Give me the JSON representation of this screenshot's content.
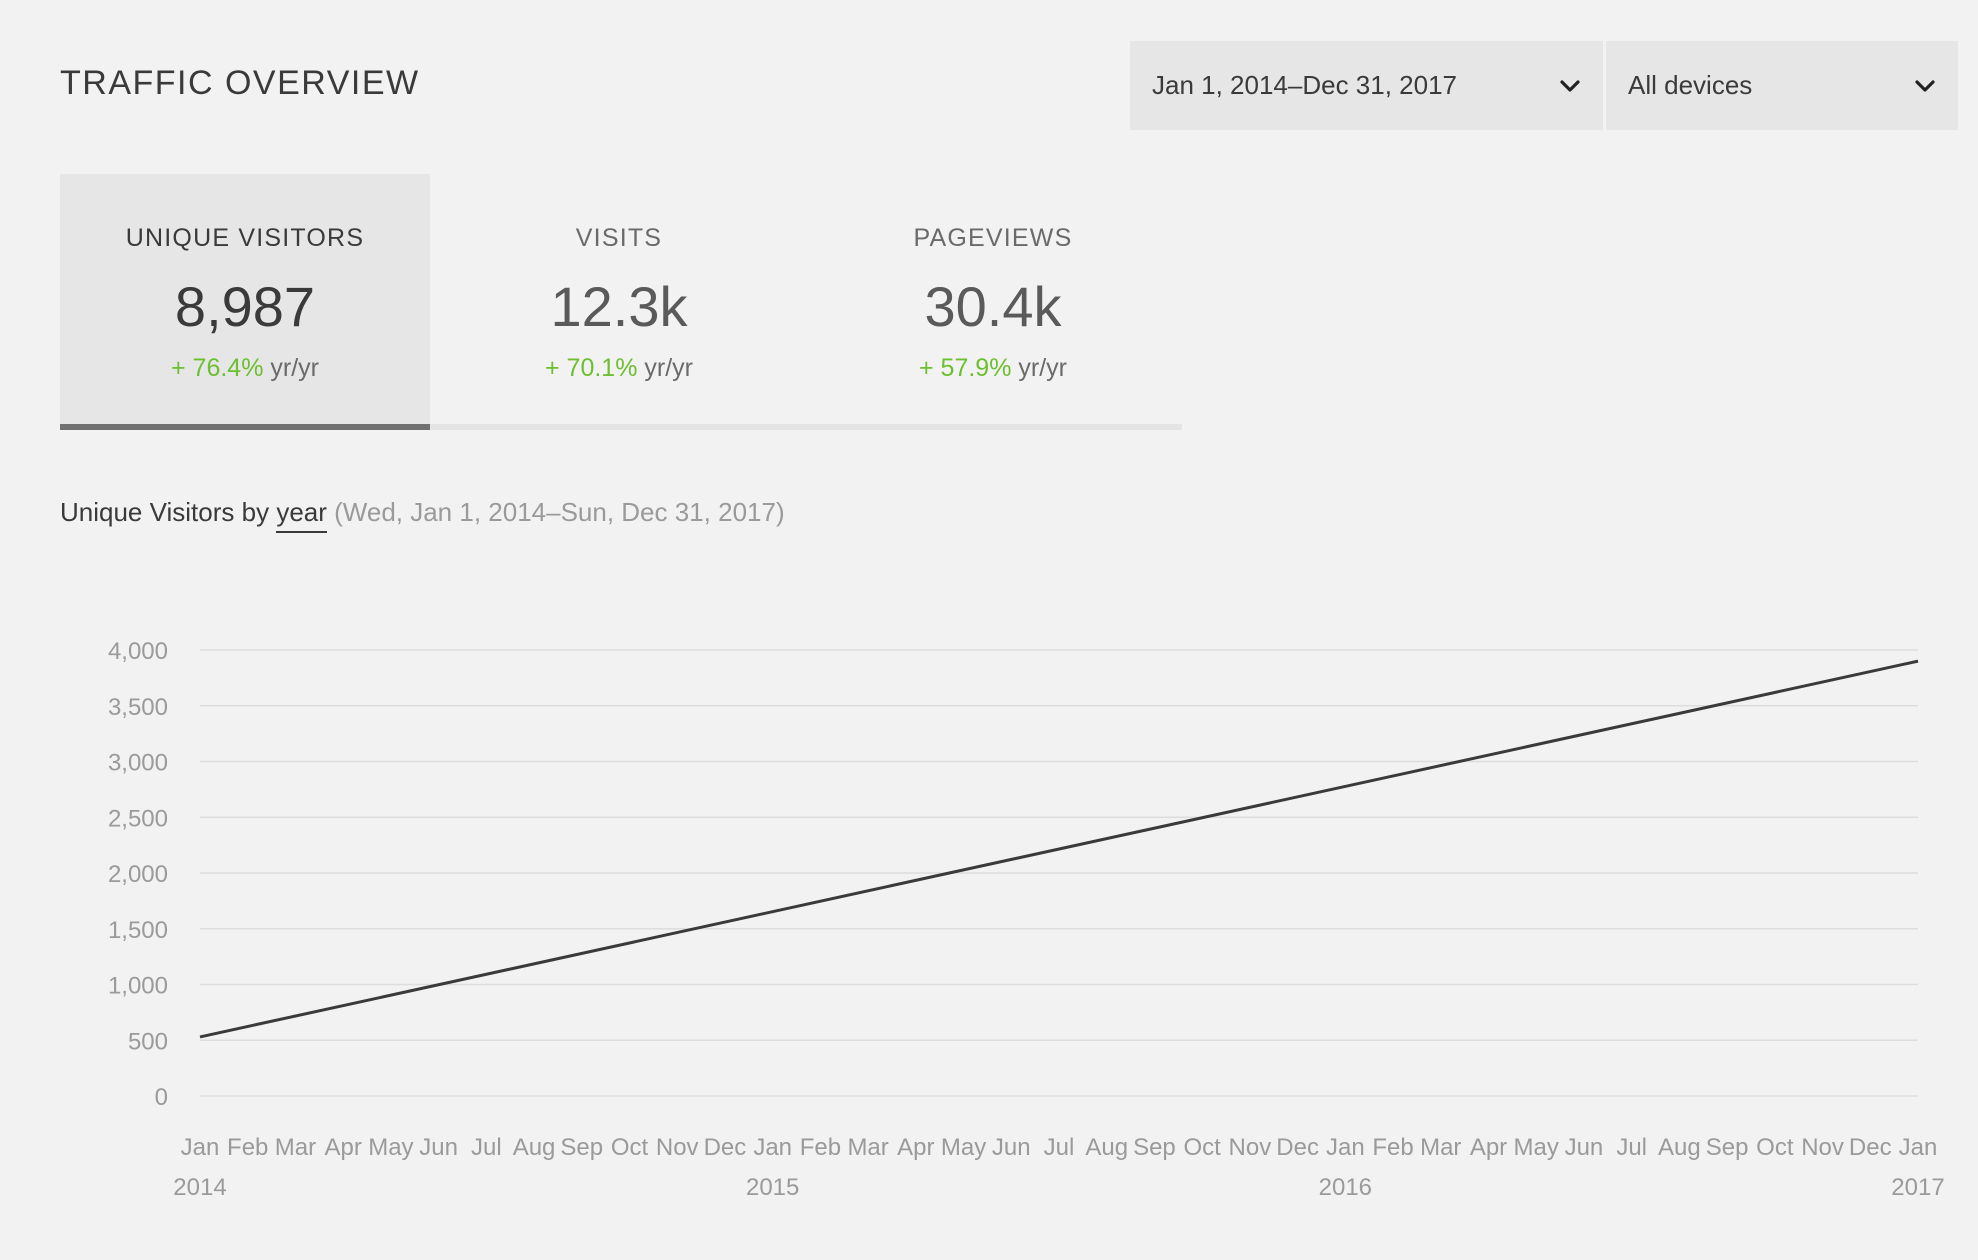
{
  "header": {
    "title": "TRAFFIC OVERVIEW",
    "date_range": "Jan 1, 2014–Dec 31, 2017",
    "device_filter": "All devices"
  },
  "icons": {
    "dropdown": "chevron-down-icon"
  },
  "metrics": [
    {
      "label": "UNIQUE VISITORS",
      "value": "8,987",
      "change": "+ 76.4%",
      "unit": "yr/yr",
      "active": true
    },
    {
      "label": "VISITS",
      "value": "12.3k",
      "change": "+ 70.1%",
      "unit": "yr/yr",
      "active": false
    },
    {
      "label": "PAGEVIEWS",
      "value": "30.4k",
      "change": "+ 57.9%",
      "unit": "yr/yr",
      "active": false
    }
  ],
  "chart_heading": {
    "prefix": "Unique Visitors by",
    "granularity": "year",
    "range": "(Wed, Jan 1, 2014–Sun, Dec 31, 2017)"
  },
  "colors": {
    "accent_positive": "#6cbf2e",
    "line": "#3a3a3a",
    "grid": "#dddddd",
    "active_tab": "#e6e6e6",
    "active_indicator": "#707070"
  },
  "chart_data": {
    "type": "line",
    "title": "",
    "xlabel": "",
    "ylabel": "",
    "ylim": [
      0,
      4000
    ],
    "xlim": [
      "2014-01-01",
      "2017-01-01"
    ],
    "yticks": [
      "4,000",
      "3,500",
      "3,000",
      "2,500",
      "2,000",
      "1,500",
      "1,000",
      "500",
      "0"
    ],
    "xticks_month": [
      "Jan",
      "Feb",
      "Mar",
      "Apr",
      "May",
      "Jun",
      "Jul",
      "Aug",
      "Sep",
      "Oct",
      "Nov",
      "Dec",
      "Jan",
      "Feb",
      "Mar",
      "Apr",
      "May",
      "Jun",
      "Jul",
      "Aug",
      "Sep",
      "Oct",
      "Nov",
      "Dec",
      "Jan",
      "Feb",
      "Mar",
      "Apr",
      "May",
      "Jun",
      "Jul",
      "Aug",
      "Sep",
      "Oct",
      "Nov",
      "Dec",
      "Jan"
    ],
    "xticks_year": [
      "2014",
      "2015",
      "2016",
      "2017"
    ],
    "grid": true,
    "series": [
      {
        "x": [
          "2014-01-01",
          "2017-01-01"
        ],
        "y": [
          530,
          3900
        ]
      }
    ]
  }
}
